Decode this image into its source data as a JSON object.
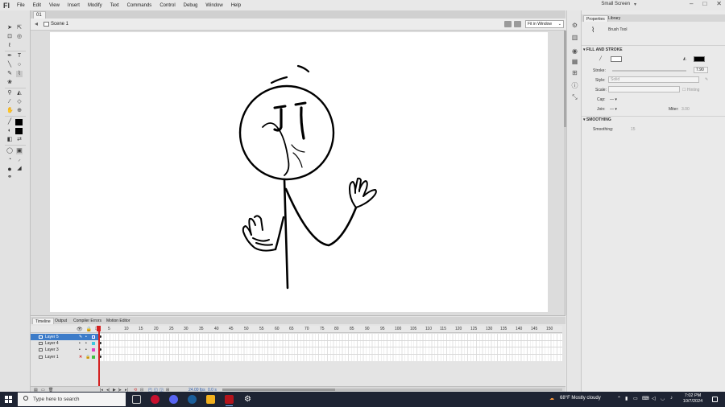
{
  "app": {
    "logo": "Fl",
    "menu": [
      "File",
      "Edit",
      "View",
      "Insert",
      "Modify",
      "Text",
      "Commands",
      "Control",
      "Debug",
      "Window",
      "Help"
    ],
    "workspace": "Small Screen",
    "window_controls": [
      "–",
      "□",
      "✕"
    ]
  },
  "document": {
    "tab": "01",
    "scene": "Scene 1",
    "zoom": "Fit in Window"
  },
  "properties": {
    "tabs": [
      "Properties",
      "Library"
    ],
    "tool_name": "Brush Tool",
    "fill_stroke_header": "FILL AND STROKE",
    "stroke_label": "Stroke:",
    "stroke_value": "7.90",
    "style_label": "Style:",
    "style_value": "Solid",
    "scale_label": "Scale:",
    "hinting_label": "Hinting",
    "cap_label": "Cap:",
    "join_label": "Join:",
    "miter_label": "Miter:",
    "miter_value": "3.00",
    "smoothing_header": "SMOOTHING",
    "smoothing_label": "Smoothing:",
    "smoothing_value": "15",
    "fill_color": "#000000",
    "stroke_color": "#ffffff"
  },
  "timeline": {
    "tabs": [
      "Timeline",
      "Output",
      "Compiler Errors",
      "Motion Editor"
    ],
    "frame_numbers": [
      "5",
      "10",
      "15",
      "20",
      "25",
      "30",
      "35",
      "40",
      "45",
      "50",
      "55",
      "60",
      "65",
      "70",
      "75",
      "80",
      "85",
      "90",
      "95",
      "100",
      "105",
      "110",
      "115",
      "120",
      "125",
      "130",
      "135",
      "140",
      "145",
      "150"
    ],
    "layers": [
      {
        "name": "Layer 5",
        "color": "#4a6cff",
        "selected": true
      },
      {
        "name": "Layer 4",
        "color": "#40c8e0",
        "selected": false
      },
      {
        "name": "Layer 3",
        "color": "#e040c0",
        "selected": false
      },
      {
        "name": "Layer 1",
        "color": "#40c040",
        "selected": false
      }
    ],
    "fps": "24.00 fps",
    "time": "0.0 s"
  },
  "taskbar": {
    "search_placeholder": "Type here to search",
    "weather": "68°F  Mostly cloudy",
    "time": "7:02 PM",
    "date": "10/7/2024",
    "apps": [
      "task-view",
      "opera",
      "discord",
      "steam",
      "file-explorer",
      "animate",
      "settings"
    ]
  }
}
